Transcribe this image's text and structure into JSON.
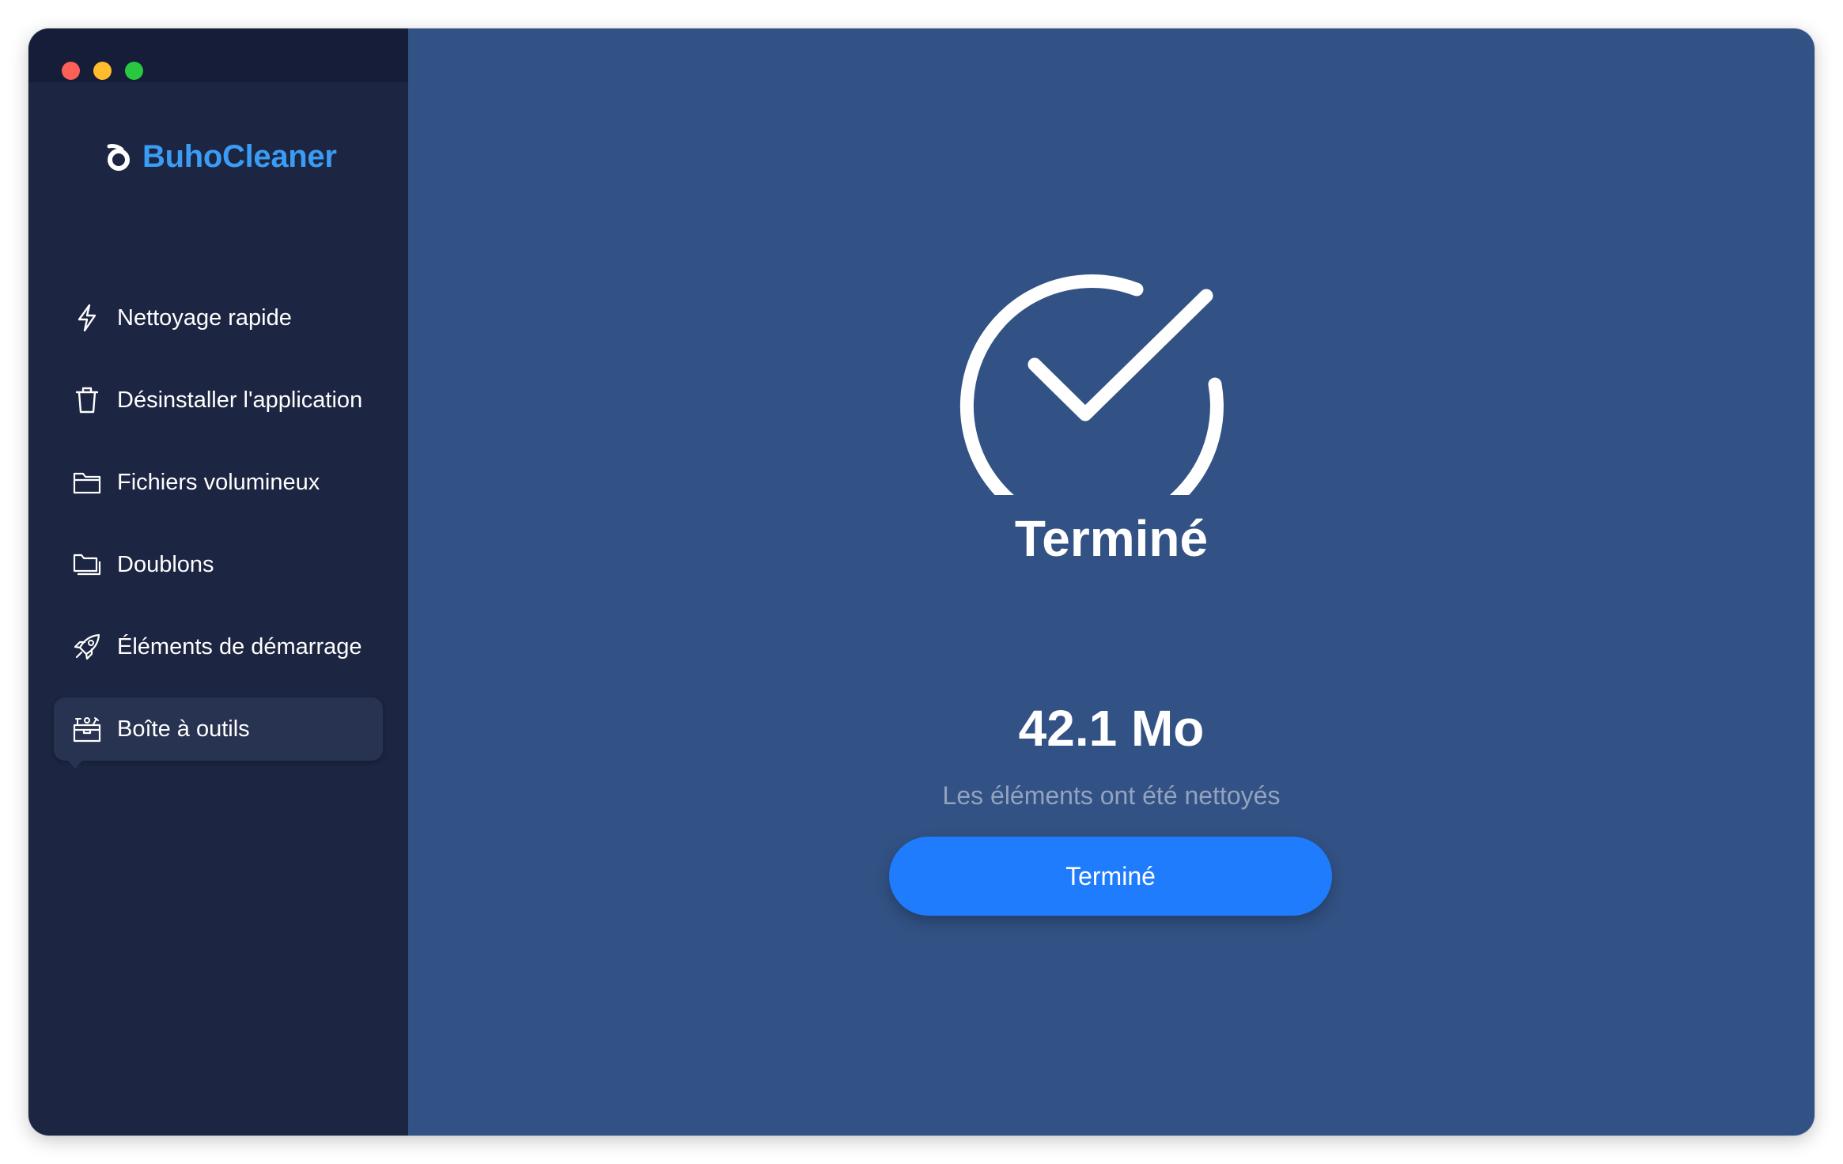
{
  "app": {
    "brand": "BuhoCleaner"
  },
  "sidebar": {
    "items": [
      {
        "label": "Nettoyage rapide",
        "icon": "lightning-icon"
      },
      {
        "label": "Désinstaller l'application",
        "icon": "trash-icon"
      },
      {
        "label": "Fichiers volumineux",
        "icon": "folder-icon"
      },
      {
        "label": "Doublons",
        "icon": "duplicate-folder-icon"
      },
      {
        "label": "Éléments de démarrage",
        "icon": "rocket-icon"
      },
      {
        "label": "Boîte à outils",
        "icon": "toolbox-icon",
        "active": true
      }
    ]
  },
  "main": {
    "status_title": "Terminé",
    "cleaned_size": "42.1 Mo",
    "cleaned_caption": "Les éléments ont été nettoyés",
    "done_button_label": "Terminé"
  },
  "colors": {
    "sidebar_bg": "#1c2541",
    "main_bg": "#325285",
    "accent": "#1f7cfd",
    "brand": "#3b9cf5"
  }
}
